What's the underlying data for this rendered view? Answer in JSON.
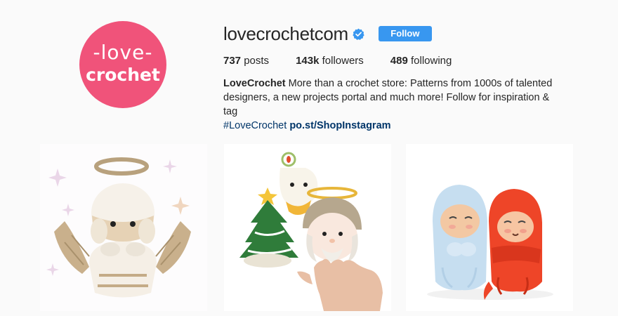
{
  "profile": {
    "avatar_text_line1": "-love-",
    "avatar_text_line2": "crochet",
    "username": "lovecrochetcom",
    "follow_label": "Follow"
  },
  "stats": {
    "posts_count": "737",
    "posts_label": " posts",
    "followers_count": "143k",
    "followers_label": " followers",
    "following_count": "489",
    "following_label": " following"
  },
  "bio": {
    "name": "LoveCrochet",
    "text": " More than a crochet store: Patterns from 1000s of talented designers, a new projects portal and much more! Follow for inspiration & tag ",
    "hashtag": "#LoveCrochet",
    "link": "po.st/ShopInstagram"
  },
  "posts": [
    {
      "subject": "crochet-angel-photo"
    },
    {
      "subject": "crochet-christmas-ornaments-photo"
    },
    {
      "subject": "crochet-bundled-dolls-photo"
    }
  ],
  "colors": {
    "accent": "#3897f0",
    "avatar_bg": "#f0537a",
    "link": "#003569",
    "verified": "#3897f0"
  }
}
